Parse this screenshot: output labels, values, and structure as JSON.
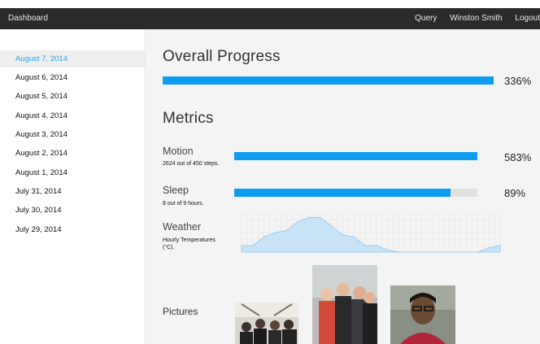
{
  "topbar": {
    "brand": "Dashboard",
    "nav": [
      "Query",
      "Winston Smith",
      "Logout"
    ]
  },
  "sidebar": {
    "items": [
      {
        "label": "August 7, 2014",
        "active": true
      },
      {
        "label": "August 6, 2014",
        "active": false
      },
      {
        "label": "August 5, 2014",
        "active": false
      },
      {
        "label": "August 4, 2014",
        "active": false
      },
      {
        "label": "August 3, 2014",
        "active": false
      },
      {
        "label": "August 2, 2014",
        "active": false
      },
      {
        "label": "August 1, 2014",
        "active": false
      },
      {
        "label": "July 31, 2014",
        "active": false
      },
      {
        "label": "July 30, 2014",
        "active": false
      },
      {
        "label": "July 29, 2014",
        "active": false
      }
    ]
  },
  "overall": {
    "title": "Overall Progress",
    "percent_label": "336%",
    "fill_fraction": 1.0
  },
  "metrics": {
    "title": "Metrics",
    "motion": {
      "label": "Motion",
      "sub": "2624 out of 450 steps.",
      "percent_label": "583%",
      "fill_fraction": 1.0
    },
    "sleep": {
      "label": "Sleep",
      "sub": "8 out of 9 hours.",
      "percent_label": "89%",
      "fill_fraction": 0.89
    },
    "weather": {
      "label": "Weather",
      "sub": "Hourly Temperatures (°C)."
    }
  },
  "pictures": {
    "title": "Pictures",
    "items": [
      "band-photo-icon",
      "band-photo-icon",
      "portrait-photo-icon"
    ]
  },
  "colors": {
    "accent": "#0c9cf0",
    "active_text": "#2aa3e8",
    "topbar": "#2b2b2b",
    "weather_fill": "#c8e3f5",
    "weather_line": "#8fc6ea"
  },
  "chart_data": {
    "type": "area",
    "x": [
      0,
      1,
      2,
      3,
      4,
      5,
      6,
      7,
      8,
      9,
      10,
      11,
      12,
      13,
      14,
      15,
      16,
      17,
      18,
      19,
      20,
      21,
      22,
      23
    ],
    "values": [
      3,
      3,
      7,
      9,
      10,
      14,
      16,
      16,
      12,
      8,
      7,
      3,
      3,
      1,
      0,
      0,
      0,
      0,
      0,
      0,
      0,
      0,
      2,
      3
    ],
    "ylim": [
      0,
      18
    ],
    "grid": true
  }
}
